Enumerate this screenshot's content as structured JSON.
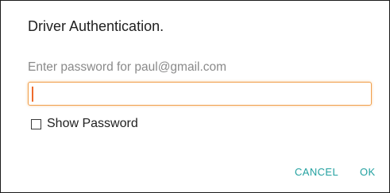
{
  "dialog": {
    "title": "Driver Authentication.",
    "prompt": "Enter password for paul@gmail.com",
    "password_value": "",
    "show_password_label": "Show Password",
    "show_password_checked": false,
    "cancel_label": "CANCEL",
    "ok_label": "OK"
  },
  "colors": {
    "accent": "#23a1a0",
    "focus_border": "#f1a04c",
    "caret": "#ee6b2c"
  }
}
